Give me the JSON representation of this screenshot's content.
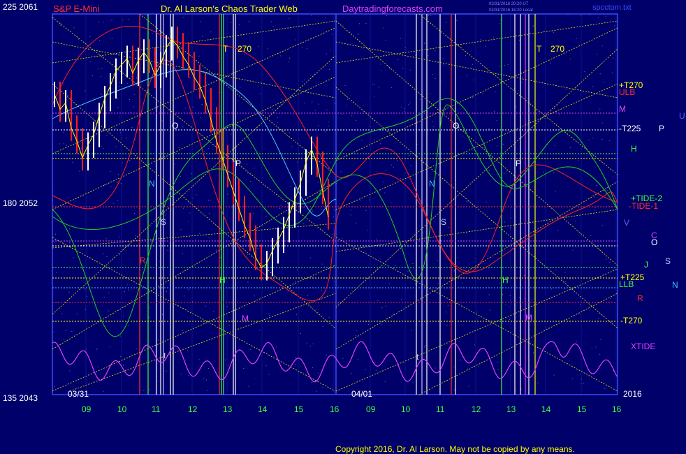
{
  "header": {
    "symbol": "S&P E-Mini",
    "title": "Dr. Al Larson's Chaos Trader Web",
    "website": "Daytradingforecasts.com",
    "stamp_line1": "03/31/2016 20:20 UT",
    "stamp_line2": "03/31/2016 16:20 Local",
    "filename": "spcctom.txt"
  },
  "copyright": "Copyright 2016, Dr. Al Larson. May not be copied by any means.",
  "colors": {
    "background": "#00006a",
    "grid": "#3a4aff",
    "price_up": "#ffffff",
    "price_down": "#ff1e1e",
    "moving_average_yellow": "#ffff00",
    "moving_average_cyan": "#4ad0ff",
    "envelope_red": "#ff2020",
    "envelope_green": "#20d020",
    "xtide": "#e040ff",
    "gann_lines": "#e6e600"
  },
  "chart_data": {
    "type": "line",
    "description_words": "intraday S&P E-Mini bars with chaos tide forecast overlay",
    "y_axis_left": {
      "ticks": [
        {
          "label": "225",
          "price": "2061"
        },
        {
          "label": "180",
          "price": "2052"
        },
        {
          "label": "135",
          "price": "2043"
        }
      ]
    },
    "x_axis": {
      "tick_labels": [
        "09",
        "10",
        "11",
        "12",
        "13",
        "14",
        "15",
        "16",
        "09",
        "10",
        "11",
        "12",
        "13",
        "14",
        "15",
        "16"
      ],
      "date_labels": [
        "03/31",
        "04/01"
      ],
      "year_label": "2016"
    },
    "right_labels": [
      {
        "text": "+T270",
        "color": "#ffff00"
      },
      {
        "text": "ULB",
        "color": "#ff3030"
      },
      {
        "text": "M",
        "color": "#e040ff"
      },
      {
        "text": "-T225",
        "color": "#ffffff"
      },
      {
        "text": "P",
        "color": "#ffffff"
      },
      {
        "text": "U",
        "color": "#6060ff"
      },
      {
        "text": "H",
        "color": "#40ff40"
      },
      {
        "text": "+TIDE-2",
        "color": "#40ff40"
      },
      {
        "text": "-TIDE-1",
        "color": "#ff3030"
      },
      {
        "text": "V",
        "color": "#6060ff"
      },
      {
        "text": "C",
        "color": "#e040ff"
      },
      {
        "text": "O",
        "color": "#ffffff"
      },
      {
        "text": "J",
        "color": "#40ff40"
      },
      {
        "text": "S",
        "color": "#c0c0ff"
      },
      {
        "text": "+T225",
        "color": "#ffff00"
      },
      {
        "text": "LLB",
        "color": "#40ff40"
      },
      {
        "text": "N",
        "color": "#40c0ff"
      },
      {
        "text": "R",
        "color": "#ff3030"
      },
      {
        "text": "-T270",
        "color": "#ffff00"
      },
      {
        "text": "XTIDE",
        "color": "#e040ff"
      }
    ],
    "in_chart_labels": [
      {
        "text": "T",
        "color": "#ffff00"
      },
      {
        "text": "270",
        "color": "#ffff00"
      },
      {
        "text": "O",
        "color": "#ffffff"
      },
      {
        "text": "P",
        "color": "#ffffff"
      },
      {
        "text": "N",
        "color": "#40c0ff"
      },
      {
        "text": "S",
        "color": "#c0c0ff"
      },
      {
        "text": "M",
        "color": "#e040ff"
      },
      {
        "text": "H",
        "color": "#40ff40"
      },
      {
        "text": "R",
        "color": "#ff3030"
      },
      {
        "text": "t",
        "color": "#c0c0ff"
      },
      {
        "text": "T",
        "color": "#ffff00"
      },
      {
        "text": "270",
        "color": "#ffff00"
      },
      {
        "text": "O",
        "color": "#ffffff"
      },
      {
        "text": "P",
        "color": "#ffffff"
      },
      {
        "text": "N",
        "color": "#40c0ff"
      },
      {
        "text": "S",
        "color": "#c0c0ff"
      },
      {
        "text": "H",
        "color": "#40ff40"
      },
      {
        "text": "M",
        "color": "#e040ff"
      },
      {
        "text": "t",
        "color": "#c0c0ff"
      }
    ],
    "price_range": [
      2043,
      2061
    ],
    "price_series_day1": [
      2057.2,
      2056.5,
      2056.8,
      2055.6,
      2055.0,
      2054.2,
      2054.8,
      2055.3,
      2056.2,
      2057.0,
      2057.6,
      2058.3,
      2058.6,
      2058.9,
      2058.2,
      2058.8,
      2059.2,
      2058.8,
      2058.1,
      2058.6,
      2059.4,
      2059.8,
      2059.5,
      2059.0,
      2058.6,
      2058.0,
      2057.6,
      2056.9,
      2056.0,
      2055.0,
      2054.2,
      2053.4,
      2052.6,
      2051.8,
      2051.0,
      2050.4,
      2049.5,
      2049.0,
      2049.2,
      2049.8,
      2050.3,
      2050.8,
      2051.5,
      2052.2,
      2053.0,
      2054.0,
      2054.6,
      2053.9,
      2052.6,
      2051.4
    ],
    "grid": true
  }
}
